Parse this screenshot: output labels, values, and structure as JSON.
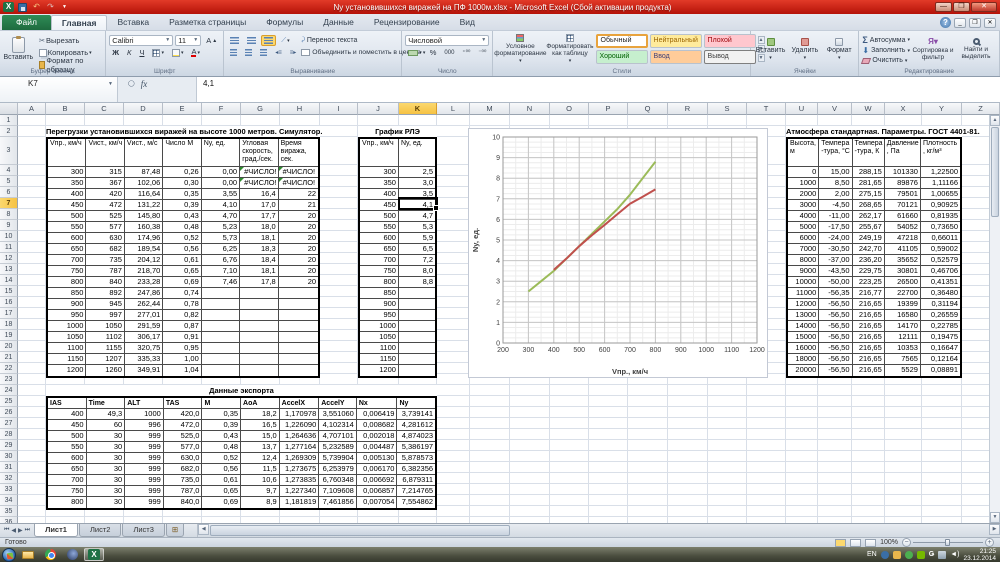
{
  "titlebar": {
    "title": "Ny установившихся виражей на ПФ 1000м.xlsx  -  Microsoft Excel (Сбой активации продукта)"
  },
  "ribbon": {
    "tabs": [
      "Файл",
      "Главная",
      "Вставка",
      "Разметка страницы",
      "Формулы",
      "Данные",
      "Рецензирование",
      "Вид"
    ],
    "active_tab": "Главная",
    "clipboard": {
      "label": "Буфер обмена",
      "paste": "Вставить",
      "cut": "Вырезать",
      "copy": "Копировать",
      "format_painter": "Формат по образцу"
    },
    "font": {
      "label": "Шрифт",
      "name": "Calibri",
      "size": "11",
      "bold": "Ж",
      "italic": "К",
      "underline": "Ч"
    },
    "alignment": {
      "label": "Выравнивание",
      "wrap": "Перенос текста",
      "merge": "Объединить и поместить в центре"
    },
    "number": {
      "label": "Число",
      "format": "Числовой",
      "percent": "%",
      "thousands": "000"
    },
    "styles": {
      "label": "Стили",
      "conditional": "Условное форматирование",
      "format_table": "Форматировать как таблицу",
      "gallery": [
        "Обычный",
        "Нейтральный",
        "Плохой",
        "Хороший",
        "Ввод",
        "Вывод"
      ]
    },
    "cells": {
      "label": "Ячейки",
      "insert": "Вставить",
      "delete": "Удалить",
      "format": "Формат"
    },
    "editing": {
      "label": "Редактирование",
      "autosum": "Автосумма",
      "fill": "Заполнить",
      "clear": "Очистить",
      "sort": "Сортировка и фильтр",
      "find": "Найти и выделить"
    }
  },
  "formula_bar": {
    "cell_ref": "K7",
    "fx": "fx",
    "value": "4,1"
  },
  "sheet": {
    "columns": [
      "A",
      "B",
      "C",
      "D",
      "E",
      "F",
      "G",
      "H",
      "I",
      "J",
      "K",
      "L",
      "M",
      "N",
      "O",
      "P",
      "Q",
      "R",
      "S",
      "T",
      "U",
      "V",
      "W",
      "X",
      "Y",
      "Z"
    ],
    "selected_column": "K",
    "selected_row": 7,
    "row_count": 37
  },
  "tables": {
    "turns": {
      "title": "Перегрузки установившихся виражей на высоте 1000 метров. Симулятор.",
      "headers": [
        "Vпр., км/ч",
        "Vист., км/ч",
        "Vист., м/с",
        "Число M",
        "Ny, ед.",
        "Угловая скорость, град./сек.",
        "Время виража, сек."
      ],
      "rows": [
        [
          "300",
          "315",
          "87,48",
          "0,26",
          "0,00",
          "#ЧИСЛО!",
          "#ЧИСЛО!"
        ],
        [
          "350",
          "367",
          "102,06",
          "0,30",
          "0,00",
          "#ЧИСЛО!",
          "#ЧИСЛО!"
        ],
        [
          "400",
          "420",
          "116,64",
          "0,35",
          "3,55",
          "16,4",
          "22"
        ],
        [
          "450",
          "472",
          "131,22",
          "0,39",
          "4,10",
          "17,0",
          "21"
        ],
        [
          "500",
          "525",
          "145,80",
          "0,43",
          "4,70",
          "17,7",
          "20"
        ],
        [
          "550",
          "577",
          "160,38",
          "0,48",
          "5,23",
          "18,0",
          "20"
        ],
        [
          "600",
          "630",
          "174,96",
          "0,52",
          "5,73",
          "18,1",
          "20"
        ],
        [
          "650",
          "682",
          "189,54",
          "0,56",
          "6,25",
          "18,3",
          "20"
        ],
        [
          "700",
          "735",
          "204,12",
          "0,61",
          "6,76",
          "18,4",
          "20"
        ],
        [
          "750",
          "787",
          "218,70",
          "0,65",
          "7,10",
          "18,1",
          "20"
        ],
        [
          "800",
          "840",
          "233,28",
          "0,69",
          "7,46",
          "17,8",
          "20"
        ],
        [
          "850",
          "892",
          "247,86",
          "0,74",
          "",
          "",
          ""
        ],
        [
          "900",
          "945",
          "262,44",
          "0,78",
          "",
          "",
          ""
        ],
        [
          "950",
          "997",
          "277,01",
          "0,82",
          "",
          "",
          ""
        ],
        [
          "1000",
          "1050",
          "291,59",
          "0,87",
          "",
          "",
          ""
        ],
        [
          "1050",
          "1102",
          "306,17",
          "0,91",
          "",
          "",
          ""
        ],
        [
          "1100",
          "1155",
          "320,75",
          "0,95",
          "",
          "",
          ""
        ],
        [
          "1150",
          "1207",
          "335,33",
          "1,00",
          "",
          "",
          ""
        ],
        [
          "1200",
          "1260",
          "349,91",
          "1,04",
          "",
          "",
          ""
        ]
      ]
    },
    "rle": {
      "title": "График РЛЭ",
      "headers": [
        "Vпр., км/ч",
        "Ny, ед."
      ],
      "rows": [
        [
          "300",
          "2,5"
        ],
        [
          "350",
          "3,0"
        ],
        [
          "400",
          "3,5"
        ],
        [
          "450",
          "4,1"
        ],
        [
          "500",
          "4,7"
        ],
        [
          "550",
          "5,3"
        ],
        [
          "600",
          "5,9"
        ],
        [
          "650",
          "6,5"
        ],
        [
          "700",
          "7,2"
        ],
        [
          "750",
          "8,0"
        ],
        [
          "800",
          "8,8"
        ],
        [
          "850",
          ""
        ],
        [
          "900",
          ""
        ],
        [
          "950",
          ""
        ],
        [
          "1000",
          ""
        ],
        [
          "1050",
          ""
        ],
        [
          "1100",
          ""
        ],
        [
          "1150",
          ""
        ],
        [
          "1200",
          ""
        ]
      ]
    },
    "atmosphere": {
      "title": "Атмосфера стандартная. Параметры. ГОСТ 4401-81.",
      "headers": [
        "Высота, м",
        "Темпера-тура, °С",
        "Темпера-тура, К",
        "Давление, Па",
        "Плотность, кг/м³"
      ],
      "rows": [
        [
          "0",
          "15,00",
          "288,15",
          "101330",
          "1,22500"
        ],
        [
          "1000",
          "8,50",
          "281,65",
          "89876",
          "1,11166"
        ],
        [
          "2000",
          "2,00",
          "275,15",
          "79501",
          "1,00655"
        ],
        [
          "3000",
          "-4,50",
          "268,65",
          "70121",
          "0,90925"
        ],
        [
          "4000",
          "-11,00",
          "262,17",
          "61660",
          "0,81935"
        ],
        [
          "5000",
          "-17,50",
          "255,67",
          "54052",
          "0,73650"
        ],
        [
          "6000",
          "-24,00",
          "249,19",
          "47218",
          "0,66011"
        ],
        [
          "7000",
          "-30,50",
          "242,70",
          "41105",
          "0,59002"
        ],
        [
          "8000",
          "-37,00",
          "236,20",
          "35652",
          "0,52579"
        ],
        [
          "9000",
          "-43,50",
          "229,75",
          "30801",
          "0,46706"
        ],
        [
          "10000",
          "-50,00",
          "223,25",
          "26500",
          "0,41351"
        ],
        [
          "11000",
          "-56,35",
          "216,77",
          "22700",
          "0,36480"
        ],
        [
          "12000",
          "-56,50",
          "216,65",
          "19399",
          "0,31194"
        ],
        [
          "13000",
          "-56,50",
          "216,65",
          "16580",
          "0,26559"
        ],
        [
          "14000",
          "-56,50",
          "216,65",
          "14170",
          "0,22785"
        ],
        [
          "15000",
          "-56,50",
          "216,65",
          "12111",
          "0,19475"
        ],
        [
          "16000",
          "-56,50",
          "216,65",
          "10353",
          "0,16647"
        ],
        [
          "18000",
          "-56,50",
          "216,65",
          "7565",
          "0,12164"
        ],
        [
          "20000",
          "-56,50",
          "216,65",
          "5529",
          "0,08891"
        ]
      ]
    },
    "export": {
      "title": "Данные экспорта",
      "headers": [
        "IAS",
        "Time",
        "ALT",
        "TAS",
        "M",
        "AoA",
        "AccelX",
        "AccelY",
        "Nx",
        "Ny"
      ],
      "rows": [
        [
          "400",
          "49,3",
          "1000",
          "420,0",
          "0,35",
          "18,2",
          "1,170978",
          "3,551060",
          "0,006419",
          "3,739141"
        ],
        [
          "450",
          "60",
          "996",
          "472,0",
          "0,39",
          "16,5",
          "1,226090",
          "4,102314",
          "0,008682",
          "4,281612"
        ],
        [
          "500",
          "30",
          "999",
          "525,0",
          "0,43",
          "15,0",
          "1,264636",
          "4,707101",
          "0,002018",
          "4,874023"
        ],
        [
          "550",
          "30",
          "999",
          "577,0",
          "0,48",
          "13,7",
          "1,277164",
          "5,232589",
          "0,004487",
          "5,386197"
        ],
        [
          "600",
          "30",
          "999",
          "630,0",
          "0,52",
          "12,4",
          "1,269309",
          "5,739904",
          "0,005130",
          "5,878573"
        ],
        [
          "650",
          "30",
          "999",
          "682,0",
          "0,56",
          "11,5",
          "1,273675",
          "6,253979",
          "0,006170",
          "6,382356"
        ],
        [
          "700",
          "30",
          "999",
          "735,0",
          "0,61",
          "10,6",
          "1,273835",
          "6,760348",
          "0,006692",
          "6,879311"
        ],
        [
          "750",
          "30",
          "999",
          "787,0",
          "0,65",
          "9,7",
          "1,227340",
          "7,109608",
          "0,006857",
          "7,214765"
        ],
        [
          "800",
          "30",
          "999",
          "840,0",
          "0,69",
          "8,9",
          "1,181819",
          "7,461856",
          "0,007054",
          "7,554862"
        ]
      ]
    }
  },
  "chart_data": {
    "type": "line",
    "xlabel": "Vпр., км/ч",
    "ylabel": "Ny, ед.",
    "xlim": [
      200,
      1200
    ],
    "ylim": [
      0,
      10
    ],
    "x_major": 100,
    "y_major": 1,
    "x_minor": 50,
    "y_minor": 0.25,
    "grid": true,
    "legend_position": "none",
    "series": [
      {
        "name": "График РЛЭ",
        "color": "#9BBB59",
        "x": [
          300,
          350,
          400,
          450,
          500,
          550,
          600,
          650,
          700,
          750,
          800
        ],
        "y": [
          2.5,
          3.0,
          3.5,
          4.1,
          4.7,
          5.3,
          5.9,
          6.5,
          7.2,
          8.0,
          8.8
        ]
      },
      {
        "name": "Симулятор",
        "color": "#C0504D",
        "x": [
          400,
          450,
          500,
          550,
          600,
          650,
          700,
          750,
          800
        ],
        "y": [
          3.55,
          4.1,
          4.7,
          5.23,
          5.73,
          6.25,
          6.76,
          7.1,
          7.46
        ]
      }
    ]
  },
  "sheet_tabs": {
    "tabs": [
      "Лист1",
      "Лист2",
      "Лист3"
    ],
    "active": "Лист1"
  },
  "status_bar": {
    "ready": "Готово",
    "zoom": "100%"
  },
  "taskbar": {
    "lang": "EN",
    "time": "21:25",
    "date": "23.12.2014"
  }
}
